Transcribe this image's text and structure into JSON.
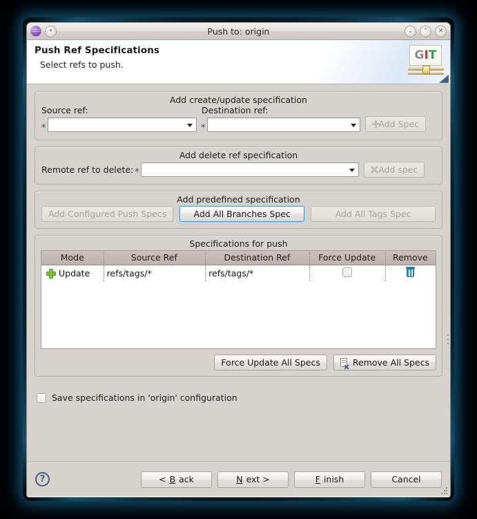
{
  "window": {
    "title": "Push to: origin",
    "icons": {
      "app": "purple-sphere-icon",
      "menu": "window-menu-icon",
      "minimize": "⌄",
      "maximize": "⌃",
      "close": "✕"
    }
  },
  "header": {
    "title": "Push Ref Specifications",
    "subtitle": "Select refs to push.",
    "logo": {
      "g": "G",
      "i": "I",
      "t": "T"
    }
  },
  "create_update": {
    "group_title": "Add create/update specification",
    "source_label": "Source ref:",
    "destination_label": "Destination ref:",
    "source_value": "",
    "destination_value": "",
    "required_marker": "*",
    "add_button": "Add Spec",
    "add_button_enabled": false
  },
  "delete_spec": {
    "group_title": "Add delete ref specification",
    "remote_label": "Remote ref to delete:",
    "remote_value": "",
    "required_marker": "*",
    "add_button": "Add spec",
    "add_button_enabled": false
  },
  "predefined": {
    "group_title": "Add predefined specification",
    "buttons": [
      {
        "label": "Add Configured Push Specs",
        "enabled": false,
        "focused": false
      },
      {
        "label": "Add All Branches Spec",
        "enabled": true,
        "focused": true
      },
      {
        "label": "Add All Tags Spec",
        "enabled": false,
        "focused": false
      }
    ]
  },
  "spec_table": {
    "group_title": "Specifications for push",
    "columns": [
      "Mode",
      "Source Ref",
      "Destination Ref",
      "Force Update",
      "Remove"
    ],
    "rows": [
      {
        "mode": "Update",
        "mode_icon": "green-plus-icon",
        "source_ref": "refs/tags/*",
        "destination_ref": "refs/tags/*",
        "force_update": false,
        "remove_icon": "trash-icon"
      }
    ]
  },
  "all_specs_actions": {
    "force_update_all": "Force Update All Specs",
    "remove_all": "Remove All Specs"
  },
  "save_option": {
    "label": "Save specifications in 'origin' configuration",
    "checked": false
  },
  "footer": {
    "help_label": "?",
    "buttons": [
      {
        "label": "< Back",
        "mnemonic": "B"
      },
      {
        "label": "Next >",
        "mnemonic": "N"
      },
      {
        "label": "Finish",
        "mnemonic": "F"
      },
      {
        "label": "Cancel",
        "mnemonic": ""
      }
    ],
    "back": "< Back",
    "next": "Next >",
    "finish": "Finish",
    "cancel": "Cancel"
  },
  "colors": {
    "window_bg": "#d6d2cd",
    "accent_focus": "#4a9ed8",
    "required_asterisk": "#2d4a8a",
    "glow": "#2a8cc0"
  }
}
